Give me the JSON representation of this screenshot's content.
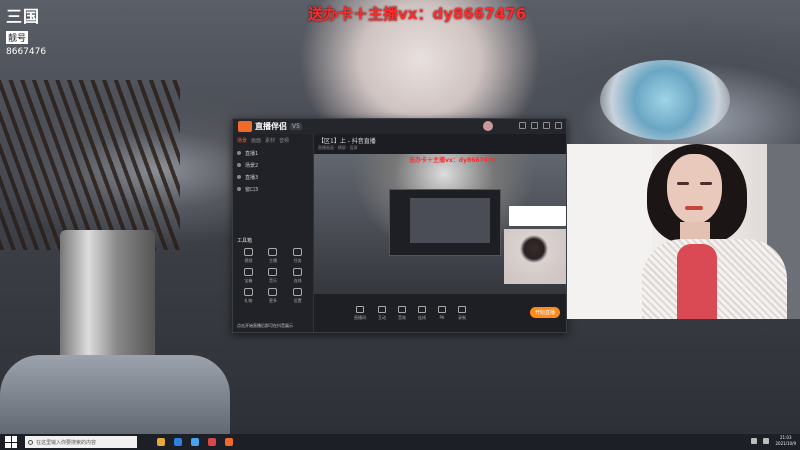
{
  "logo": {
    "line1": "三国",
    "line2": "靓号",
    "line3": "8667476"
  },
  "banner": {
    "text": "送办卡＋主播vx：dy8667476"
  },
  "app": {
    "name": "直播伴侣",
    "version": "V5",
    "left_tabs": [
      "场景",
      "画面",
      "素材",
      "音频"
    ],
    "scenes": [
      "直播1",
      "场景2",
      "直播3",
      "窗口3"
    ],
    "tools_title": "工具箱",
    "tools": [
      "视频",
      "主播",
      "任务",
      "宝箱",
      "音乐",
      "连线",
      "礼物",
      "更多",
      "设置"
    ],
    "footer": "点击开始直播后即可在抖音展示",
    "preview_title": "【区1】上 - 抖音直播",
    "preview_sub": "直播画面 · 横屏 · 竖屏",
    "preview_banner": "送办卡＋主播vx：dy8667476",
    "toolbar": [
      "直播间",
      "互动",
      "音效",
      "连线",
      "PK",
      "录制"
    ],
    "live_button": "开始直播"
  },
  "taskbar": {
    "search_placeholder": "在这里输入你要搜索的内容",
    "time": "21:03",
    "date": "2021/10/9"
  },
  "colors": {
    "banner": "#ff2a2a",
    "accent": "#ff8a1a",
    "taskbar": "#1c1f26"
  }
}
